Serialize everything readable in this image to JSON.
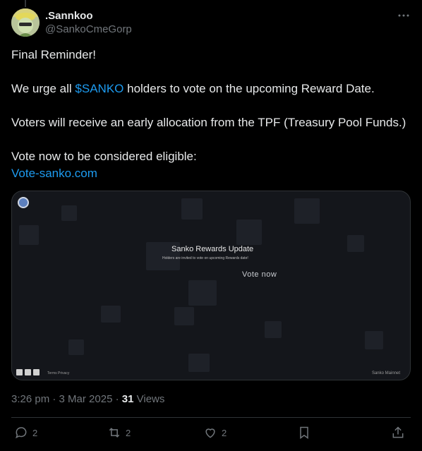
{
  "author": {
    "display_name": ".Sannkoo",
    "handle": "@SankoCmeGorp"
  },
  "post": {
    "line1": "Final Reminder!",
    "line2_pre": "We urge all ",
    "line2_tag": "$SANKO",
    "line2_post": " holders to vote on the upcoming Reward Date.",
    "line3": "Voters will receive an early allocation from the TPF (Treasury Pool Funds.)",
    "line4": "Vote now to be considered eligible:",
    "link": "Vote-sanko.com"
  },
  "media": {
    "title": "Sanko Rewards Update",
    "subtitle": "Holders are invited to vote on upcoming Rewards date!",
    "vote_label": "Vote now",
    "footer_links": "Terms   Privacy",
    "footer_right": "Sanko Mainnet"
  },
  "meta": {
    "time": "3:26 pm",
    "sep1": " · ",
    "date": "3 Mar 2025",
    "sep2": " · ",
    "views_count": "31",
    "views_label": " Views"
  },
  "actions": {
    "replies": "2",
    "reposts": "2",
    "likes": "2"
  },
  "colors": {
    "accent": "#1d9bf0",
    "secondary_text": "#71767b",
    "background": "#000000"
  }
}
